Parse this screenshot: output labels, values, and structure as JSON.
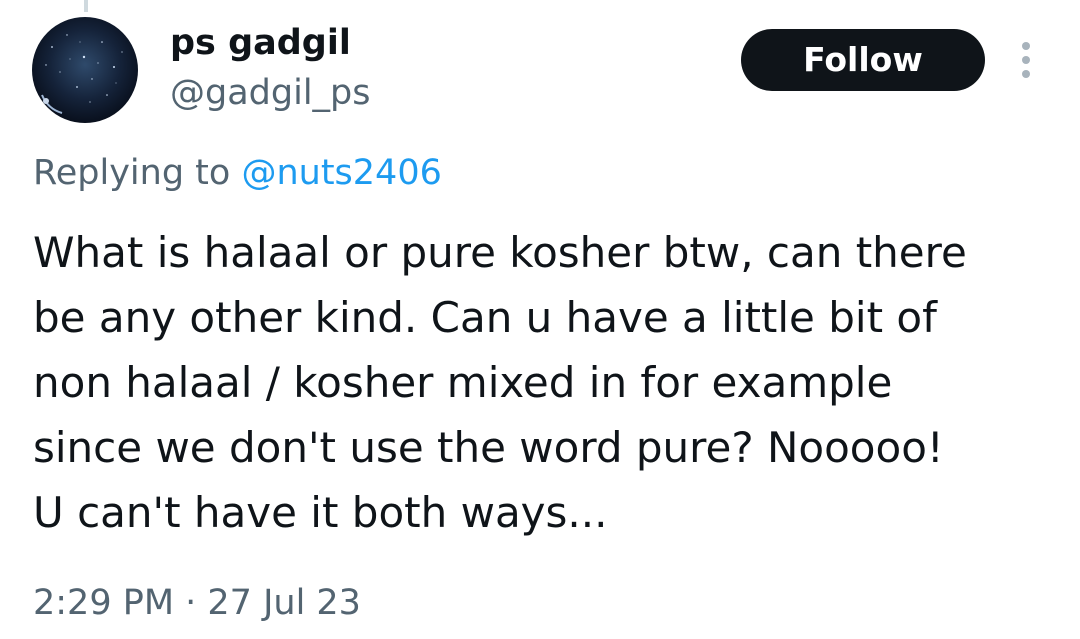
{
  "author": {
    "display_name": "ps gadgil",
    "handle": "@gadgil_ps",
    "avatar_icon": "starry-night-avatar"
  },
  "actions": {
    "follow_label": "Follow",
    "more_icon": "more-vertical-icon"
  },
  "reply": {
    "prefix": "Replying to ",
    "to_handle": "@nuts2406"
  },
  "tweet": {
    "lines": [
      "What is halaal or pure kosher btw, can there",
      "be any other kind. Can u have a little bit of",
      "non halaal / kosher mixed in for example",
      "since we don't use the word pure? Nooooo!",
      "U can't have it both ways..."
    ]
  },
  "meta": {
    "timestamp": "2:29 PM · 27 Jul 23"
  },
  "colors": {
    "text_primary": "#0f1419",
    "text_secondary": "#536471",
    "link": "#1d9bf0",
    "button_bg": "#0f1419",
    "button_text": "#ffffff"
  }
}
